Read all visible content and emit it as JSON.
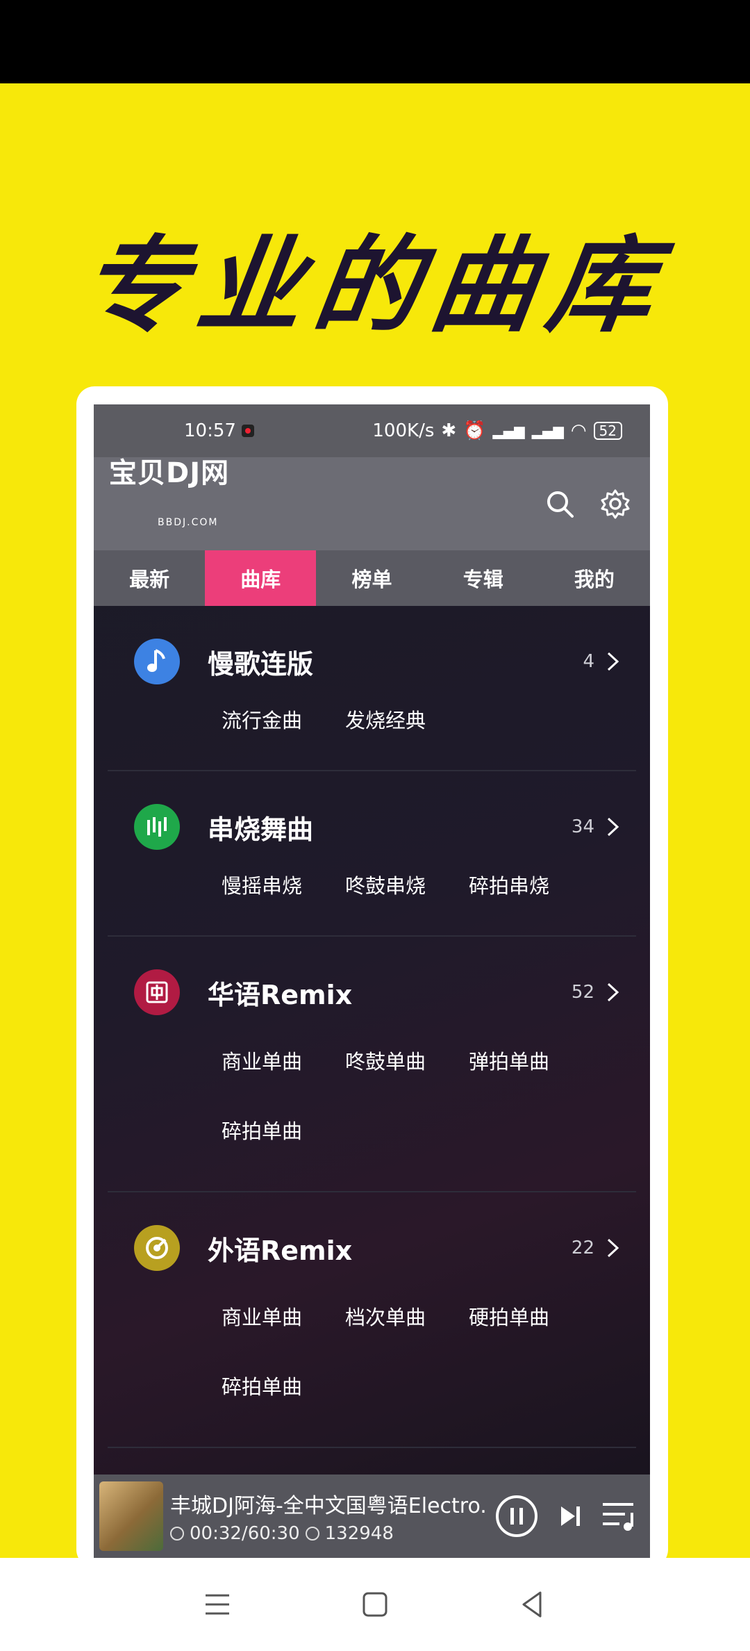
{
  "headline": "专业的曲库",
  "status": {
    "time": "10:57",
    "speed": "100K/s",
    "battery": "52"
  },
  "app": {
    "logo_main": "宝贝DJ网",
    "logo_sub": "BBDJ.COM"
  },
  "tabs": [
    {
      "label": "最新",
      "active": false
    },
    {
      "label": "曲库",
      "active": true
    },
    {
      "label": "榜单",
      "active": false
    },
    {
      "label": "专辑",
      "active": false
    },
    {
      "label": "我的",
      "active": false
    }
  ],
  "categories": [
    {
      "title": "慢歌连版",
      "count": "4",
      "icon": "music-note-icon",
      "color": "#3d82e3",
      "subs": [
        "流行金曲",
        "发烧经典"
      ]
    },
    {
      "title": "串烧舞曲",
      "count": "34",
      "icon": "equalizer-icon",
      "color": "#1fa84a",
      "subs": [
        "慢摇串烧",
        "咚鼓串烧",
        "碎拍串烧"
      ]
    },
    {
      "title": "华语Remix",
      "count": "52",
      "icon": "chinese-char-icon",
      "color": "#b11b43",
      "subs": [
        "商业单曲",
        "咚鼓单曲",
        "弹拍单曲",
        "碎拍单曲"
      ]
    },
    {
      "title": "外语Remix",
      "count": "22",
      "icon": "vinyl-icon",
      "color": "#b8a020",
      "subs": [
        "商业单曲",
        "档次单曲",
        "硬拍单曲",
        "碎拍单曲"
      ]
    }
  ],
  "player": {
    "title": "丰城DJ阿海-全中文国粤语Electro.",
    "time": "00:32/60:30",
    "id": "132948"
  }
}
